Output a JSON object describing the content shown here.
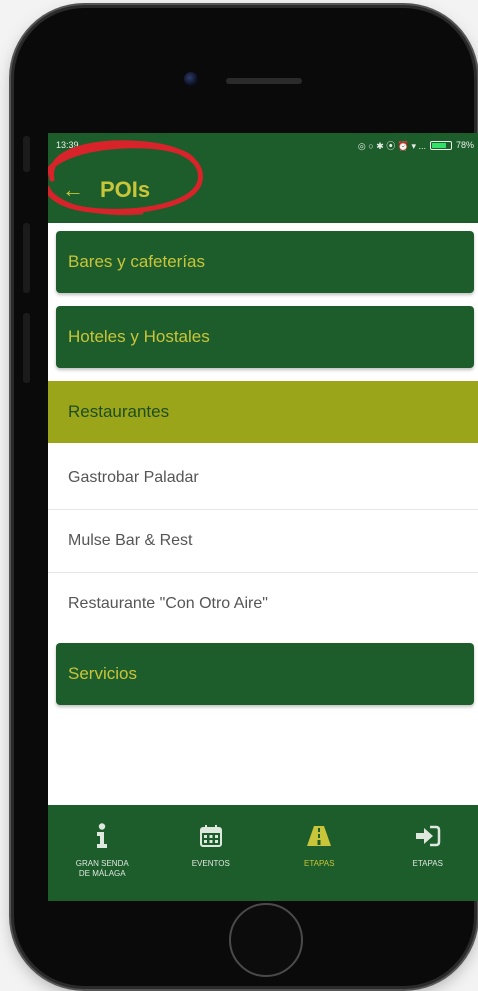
{
  "status_bar": {
    "time": "13:39",
    "icons": "◎ ○ ✱ ⦿ ⏰ ▾ ...",
    "battery": "78%"
  },
  "app_bar": {
    "back_icon": "arrow-left-icon",
    "title": "POIs"
  },
  "categories": [
    {
      "label": "Bares y cafeterías"
    },
    {
      "label": "Hoteles y Hostales"
    }
  ],
  "active_category": {
    "label": "Restaurantes"
  },
  "restaurants": [
    {
      "label": "Gastrobar Paladar"
    },
    {
      "label": "Mulse Bar & Rest"
    },
    {
      "label": "Restaurante \"Con Otro Aire\""
    }
  ],
  "after_category": {
    "label": "Servicios"
  },
  "bottom_nav": [
    {
      "icon": "info-icon",
      "label": "GRAN SENDA\nDE MÁLAGA"
    },
    {
      "icon": "calendar-icon",
      "label": "EVENTOS"
    },
    {
      "icon": "road-icon",
      "label": "ETAPAS",
      "active": true
    },
    {
      "icon": "sign-in-icon",
      "label": "ETAPAS"
    }
  ],
  "colors": {
    "primary": "#1d5d2b",
    "accent": "#c8c53a",
    "active_row": "#9aa51a",
    "annotation": "#d8232a"
  }
}
